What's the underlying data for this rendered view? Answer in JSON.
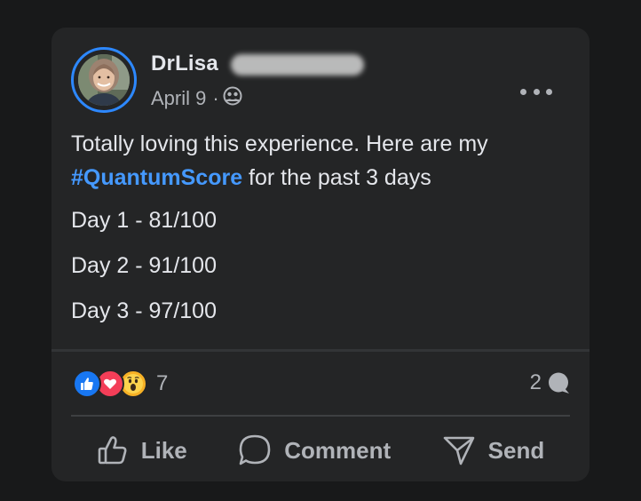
{
  "post": {
    "author_name": "DrLisa",
    "date": "April 9",
    "separator": "·",
    "privacy_icon": "friends-icon",
    "more_icon": "more-options-icon",
    "text_intro": "Totally loving this experience. Here are my",
    "hashtag": "#QuantumScore",
    "text_outro": " for the past 3 days",
    "lines": [
      "Day 1 - 81/100",
      "Day 2 - 91/100",
      "Day 3 - 97/100"
    ]
  },
  "stats": {
    "reaction_icons": [
      "like-reaction-icon",
      "love-reaction-icon",
      "wow-reaction-icon"
    ],
    "reaction_count": "7",
    "comment_count": "2",
    "comment_icon": "comment-bubble-icon"
  },
  "actions": {
    "like_label": "Like",
    "comment_label": "Comment",
    "send_label": "Send"
  },
  "colors": {
    "background": "#18191a",
    "card": "#242526",
    "text_primary": "#e4e6eb",
    "text_secondary": "#b0b3b8",
    "hashtag": "#4599ff",
    "avatar_ring": "#2d88ff",
    "like_blue": "#1877f2",
    "love_red": "#f33e58",
    "wow_yellow": "#f7b125"
  }
}
